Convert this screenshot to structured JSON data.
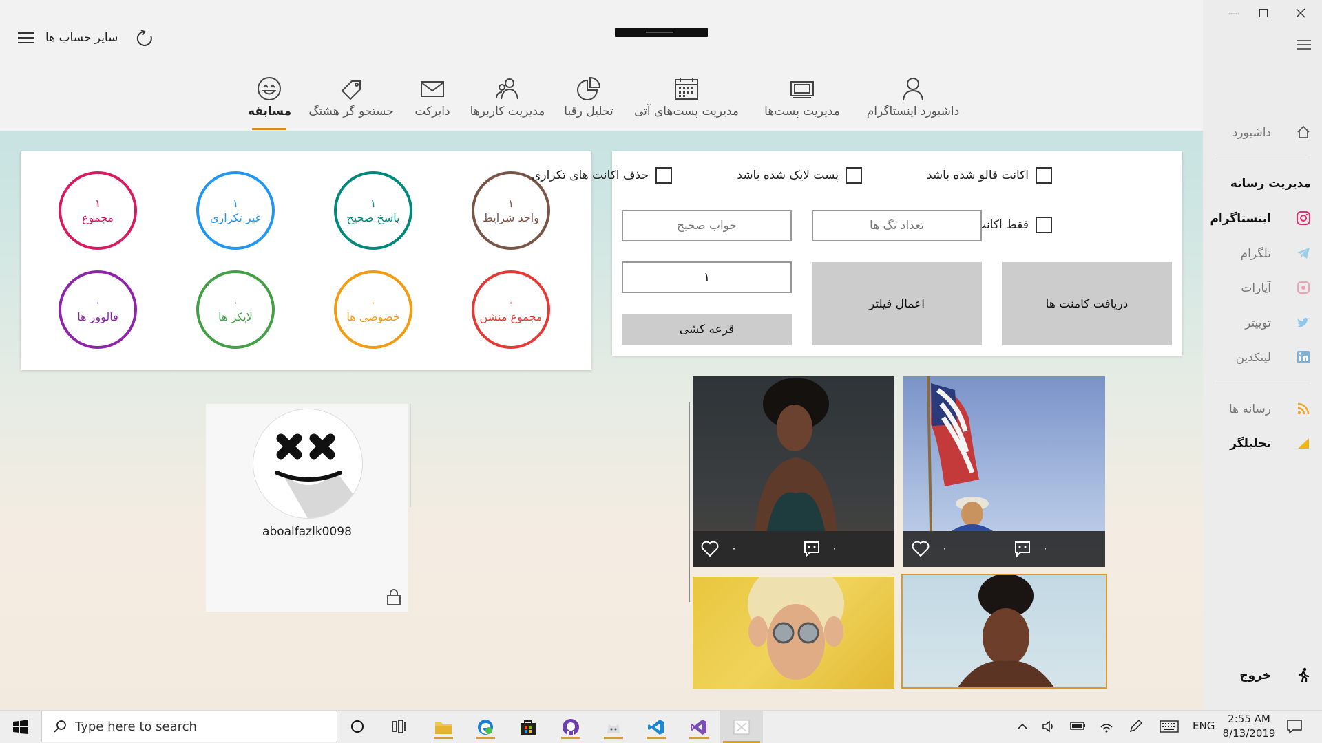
{
  "topbar": {
    "accounts_label": "سایر حساب ها"
  },
  "tabs": [
    {
      "label": "مسابقه",
      "icon": "smile-icon",
      "active": true
    },
    {
      "label": "جستجو گر هشتگ",
      "icon": "tag-icon"
    },
    {
      "label": "دایرکت",
      "icon": "mail-icon"
    },
    {
      "label": "مدیریت کاربرها",
      "icon": "users-icon"
    },
    {
      "label": "تحلیل رقبا",
      "icon": "pie-chart-icon"
    },
    {
      "label": "مدیریت پست‌های آتی",
      "icon": "calendar-icon"
    },
    {
      "label": "مدیریت پست‌ها",
      "icon": "posts-icon"
    },
    {
      "label": "داشبورد اینستاگرام",
      "icon": "user-icon"
    }
  ],
  "stats": [
    {
      "value": "۱",
      "label": "واجد شرایط",
      "color": "#795548"
    },
    {
      "value": "۱",
      "label": "پاسخ صحیح",
      "color": "#00897b"
    },
    {
      "value": "۱",
      "label": "غیر تکراری",
      "color": "#2196f3"
    },
    {
      "value": "۱",
      "label": "مجموع",
      "color": "#d81b60"
    },
    {
      "value": "۰",
      "label": "مجموع منشن",
      "color": "#e53935"
    },
    {
      "value": "۰",
      "label": "خصوصی ها",
      "color": "#f39c12"
    },
    {
      "value": "۰",
      "label": "لایکر ها",
      "color": "#43a047"
    },
    {
      "value": "۰",
      "label": "فالوور ها",
      "color": "#8e24aa"
    }
  ],
  "filters": {
    "followed": "اکانت فالو شده باشد",
    "liked": "پست لایک شده باشد",
    "remove_duplicates": "حذف اکانت های تکراری",
    "private_only": "فقط اکانت های خصوصی",
    "tag_count_placeholder": "تعداد تگ ها",
    "answer_placeholder": "جواب صحیح",
    "winners_count": "۱",
    "get_comments_button": "دریافت کامنت ها",
    "apply_filter_button": "اعمال فیلتر",
    "draw_button": "قرعه کشی"
  },
  "winner": {
    "username": "aboalfazlk0098"
  },
  "photos": [
    {
      "likes": "۰",
      "comments": "۰"
    },
    {
      "likes": "۰",
      "comments": "۰"
    }
  ],
  "sidebar": {
    "dashboard": "داشبورد",
    "media_heading": "مدیریت رسانه",
    "items": [
      {
        "label": "اینستاگرام",
        "icon": "instagram-icon",
        "color": "#e1306c",
        "active": true
      },
      {
        "label": "تلگرام",
        "icon": "telegram-icon",
        "color": "#9ecde9"
      },
      {
        "label": "آپارات",
        "icon": "aparat-icon",
        "color": "#f4a0b8"
      },
      {
        "label": "توییتر",
        "icon": "twitter-icon",
        "color": "#8fc7ec"
      },
      {
        "label": "لینکدین",
        "icon": "linkedin-icon",
        "color": "#7fb0d6"
      }
    ],
    "media": "رسانه ها",
    "analytics": "تحلیلگر",
    "exit": "خروج"
  },
  "taskbar": {
    "search_placeholder": "Type here to search",
    "lang": "ENG",
    "time": "2:55 AM",
    "date": "8/13/2019"
  }
}
